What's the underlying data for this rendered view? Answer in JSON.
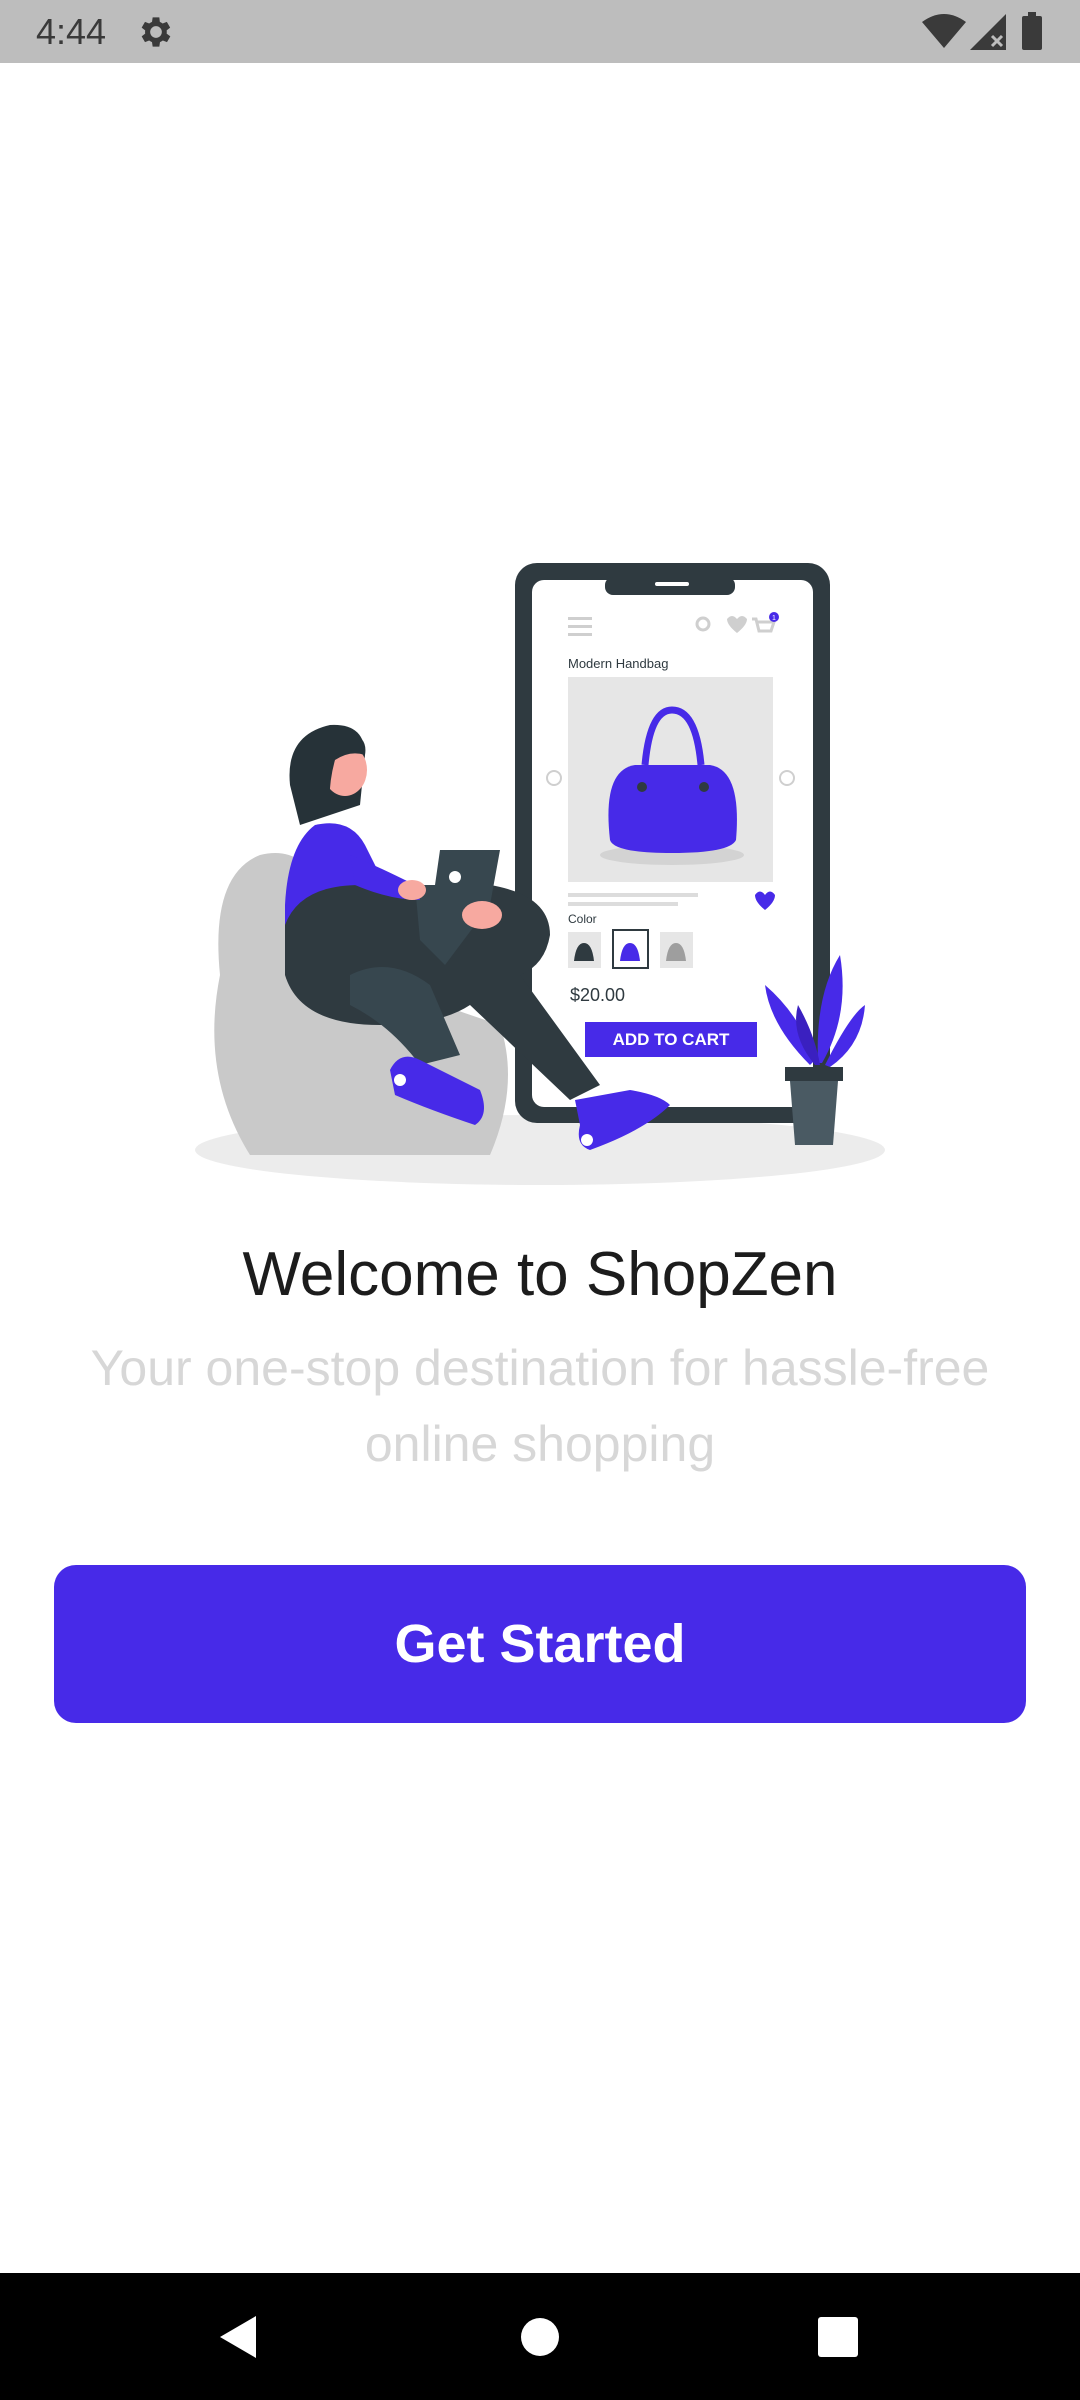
{
  "status_bar": {
    "time": "4:44",
    "icons": [
      "gear-icon",
      "wifi-icon",
      "cell-signal-icon",
      "battery-icon"
    ]
  },
  "illustration": {
    "product_title": "Modern Handbag",
    "color_label": "Color",
    "price": "$20.00",
    "cart_button": "ADD TO CART",
    "cart_badge": "1"
  },
  "onboarding": {
    "title": "Welcome to ShopZen",
    "subtitle": "Your one-stop destination for hassle-free online shopping",
    "button_label": "Get Started"
  },
  "nav_bar": {
    "icons": [
      "back-icon",
      "home-icon",
      "recents-icon"
    ]
  },
  "colors": {
    "brand": "#472ae8",
    "title_text": "#1c1c1c",
    "subtitle_text": "#d7d7d7",
    "status_bar_bg": "#bdbdbd",
    "nav_bar_bg": "#000000",
    "device_frame": "#2f3a40"
  }
}
